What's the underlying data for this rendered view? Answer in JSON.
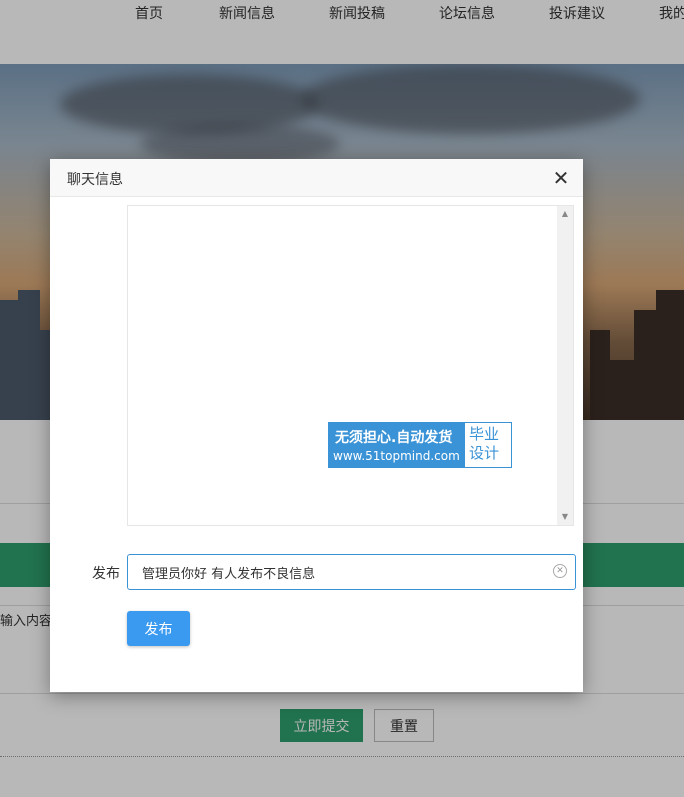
{
  "nav": {
    "items": [
      "首页",
      "新闻信息",
      "新闻投稿",
      "论坛信息",
      "投诉建议",
      "我的"
    ]
  },
  "form_bg": {
    "input_label": "输入内容",
    "submit_label": "立即提交",
    "reset_label": "重置"
  },
  "modal": {
    "title": "聊天信息",
    "close_glyph": "✕",
    "field_label": "发布",
    "input_value": "管理员你好 有人发布不良信息",
    "publish_label": "发布"
  },
  "watermark": {
    "line1": "无须担心.自动发货",
    "line2": "www.51topmind.com",
    "right_line1": "毕业",
    "right_line2": "设计"
  },
  "colors": {
    "primary_blue": "#3a9af0",
    "brand_green": "#2e9e6c"
  },
  "icons": {
    "close": "close-icon",
    "clear": "clear-circle-icon",
    "scroll_up": "triangle-up-icon",
    "scroll_down": "triangle-down-icon"
  }
}
